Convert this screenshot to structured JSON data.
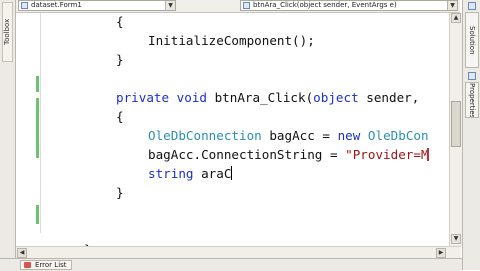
{
  "left_toolbox": {
    "label": "Toolbox"
  },
  "editor": {
    "type_combo": {
      "text": "dataset.Form1"
    },
    "member_combo": {
      "text": "btnAra_Click(object sender, EventArgs e)"
    },
    "lines": {
      "l1": "{",
      "l2": "InitializeComponent();",
      "l3": "}",
      "l5_kw": "private void ",
      "l5_rest": "btnAra_Click(",
      "l5_kw2": "object",
      "l5_end": " sender,",
      "l6": "{",
      "l7_type": "OleDbConnection",
      "l7_mid": " bagAcc = ",
      "l7_kw": "new ",
      "l7_type2": "OleDbCon",
      "l8_code": "bagAcc.ConnectionString = ",
      "l8_str": "\"Provider=M",
      "l9_kw": "string",
      "l9_rest": " araC",
      "l10": "}",
      "l13": "}"
    }
  },
  "right_panel": {
    "solution_explorer": "Solution Explorer",
    "properties": "Properties"
  },
  "bottom": {
    "error_list": "Error List"
  },
  "colors": {
    "keyword": "#1b2fd6",
    "type": "#2b91af",
    "string": "#a31515",
    "changed_line": "#6bc36b"
  }
}
